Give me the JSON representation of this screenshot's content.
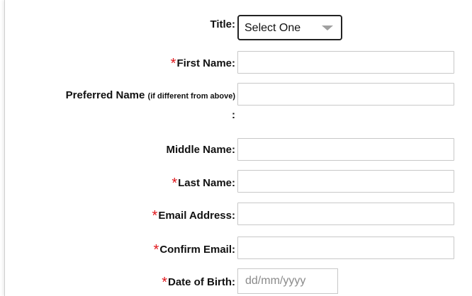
{
  "form": {
    "title": {
      "label": "Title:",
      "select_value": "Select One"
    },
    "first_name": {
      "required_mark": "*",
      "label": "First Name:",
      "value": ""
    },
    "preferred_name": {
      "label": "Preferred Name",
      "sublabel": "(if different from above)",
      "colon": ":",
      "value": ""
    },
    "middle_name": {
      "label": "Middle Name:",
      "value": ""
    },
    "last_name": {
      "required_mark": "*",
      "label": "Last Name:",
      "value": ""
    },
    "email": {
      "required_mark": "*",
      "label": "Email Address:",
      "value": ""
    },
    "confirm_email": {
      "required_mark": "*",
      "label": "Confirm Email:",
      "value": ""
    },
    "date_of_birth": {
      "required_mark": "*",
      "label": "Date of Birth:",
      "placeholder": "dd/mm/yyyy"
    }
  },
  "colors": {
    "required": "#e0161b",
    "input_border": "#c8c8c8",
    "select_border": "#222222",
    "placeholder": "#8a8a8a"
  },
  "icons": {
    "select_arrow": "chevron-down-icon"
  }
}
